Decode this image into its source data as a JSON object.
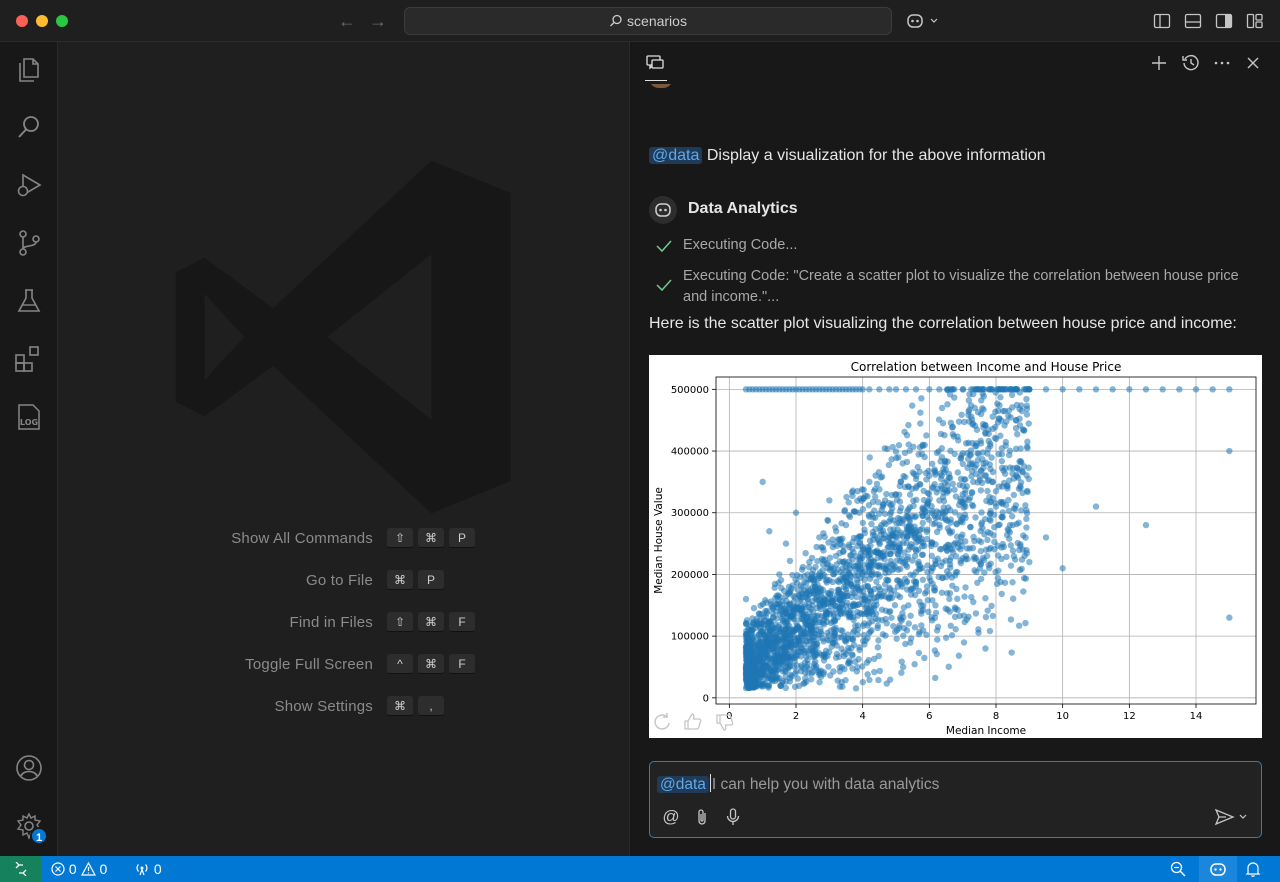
{
  "window": {
    "title": "scenarios"
  },
  "editor": {
    "shortcuts": [
      {
        "label": "Show All Commands",
        "keys": [
          "⇧",
          "⌘",
          "P"
        ]
      },
      {
        "label": "Go to File",
        "keys": [
          "⌘",
          "P"
        ]
      },
      {
        "label": "Find in Files",
        "keys": [
          "⇧",
          "⌘",
          "F"
        ]
      },
      {
        "label": "Toggle Full Screen",
        "keys": [
          "^",
          "⌘",
          "F"
        ]
      },
      {
        "label": "Show Settings",
        "keys": [
          "⌘",
          ","
        ]
      }
    ]
  },
  "activity_bar": {
    "items": [
      "explorer-icon",
      "search-icon",
      "run-debug-icon",
      "source-control-icon",
      "testing-icon",
      "extensions-icon",
      "log-icon"
    ],
    "log_label": "LOG",
    "settings_badge": "1"
  },
  "chat": {
    "user_mention": "@data",
    "user_message": "Display a visualization for the above information",
    "agent_name": "Data Analytics",
    "steps": [
      {
        "text": "Executing Code..."
      },
      {
        "text": "Executing Code: \"Create a scatter plot to visualize the correlation between house price and income.\"..."
      }
    ],
    "response_text": "Here is the scatter plot visualizing the correlation between house price and income:",
    "input": {
      "mention": "@data",
      "placeholder": "I can help you with data analytics"
    }
  },
  "chart_data": {
    "type": "scatter",
    "title": "Correlation between Income and House Price",
    "xlabel": "Median Income",
    "ylabel": "Median House Value",
    "xlim": [
      -0.4,
      15.8
    ],
    "ylim": [
      -10000,
      520000
    ],
    "xticks": [
      0,
      2,
      4,
      6,
      8,
      10,
      12,
      14
    ],
    "yticks": [
      0,
      100000,
      200000,
      300000,
      400000,
      500000
    ],
    "ytick_labels": [
      "0",
      "100000",
      "200000",
      "300000",
      "400000",
      "500000"
    ],
    "grid": true,
    "color": "#1f77b4",
    "series": [
      {
        "x": [
          0.5,
          0.6,
          0.7,
          0.8,
          0.9,
          1.0,
          1.1,
          1.2,
          1.3,
          1.4,
          1.5,
          1.6,
          1.7,
          1.8,
          1.9,
          2.0,
          2.1,
          2.2,
          2.3,
          2.4,
          2.5,
          2.6,
          2.7,
          2.8,
          2.9,
          3.0,
          3.1,
          3.2,
          3.3,
          3.4,
          3.5,
          3.6,
          3.7,
          3.8,
          3.9,
          4.0,
          4.2,
          4.5,
          4.8,
          5.0,
          5.3,
          5.6,
          6.0,
          6.3,
          6.7,
          7.0,
          7.4,
          7.8,
          8.2,
          8.6,
          9.0,
          9.5,
          10.0,
          10.5,
          11.0,
          11.5,
          12.0,
          12.5,
          13.0,
          13.5,
          14.0,
          14.5,
          15.0
        ],
        "y": [
          500000,
          500000,
          500000,
          500000,
          500000,
          500000,
          500000,
          500000,
          500000,
          500000,
          500000,
          500000,
          500000,
          500000,
          500000,
          500000,
          500000,
          500000,
          500000,
          500000,
          500000,
          500000,
          500000,
          500000,
          500000,
          500000,
          500000,
          500000,
          500000,
          500000,
          500000,
          500000,
          500000,
          500000,
          500000,
          500000,
          500000,
          500000,
          500000,
          500000,
          500000,
          500000,
          500000,
          500000,
          500000,
          500000,
          500000,
          500000,
          500000,
          500000,
          500000,
          500000,
          500000,
          500000,
          500000,
          500000,
          500000,
          500000,
          500000,
          500000,
          500000,
          500000,
          500000
        ]
      },
      {
        "x": [
          0.5,
          0.7,
          0.9,
          1.0,
          1.2,
          1.4,
          1.5,
          1.7,
          1.9,
          2.0,
          2.2,
          2.4,
          2.5,
          2.7,
          2.9,
          3.0,
          3.2,
          3.4,
          3.5,
          3.7,
          3.9,
          4.0,
          4.2,
          4.4,
          4.6,
          4.8,
          5.0,
          5.2,
          5.4,
          5.6,
          5.8,
          6.0,
          6.3,
          6.6,
          7.0,
          7.3,
          7.7,
          8.0,
          8.5,
          9.0,
          9.5,
          10.0,
          11.0,
          12.5,
          15.0,
          15.0
        ],
        "y": [
          160000,
          120000,
          90000,
          350000,
          270000,
          140000,
          200000,
          250000,
          110000,
          300000,
          180000,
          220000,
          150000,
          260000,
          190000,
          320000,
          230000,
          210000,
          280000,
          170000,
          300000,
          240000,
          350000,
          200000,
          310000,
          260000,
          330000,
          380000,
          290000,
          340000,
          410000,
          360000,
          300000,
          270000,
          330000,
          380000,
          240000,
          310000,
          280000,
          220000,
          260000,
          210000,
          310000,
          280000,
          130000,
          400000
        ]
      }
    ]
  }
}
